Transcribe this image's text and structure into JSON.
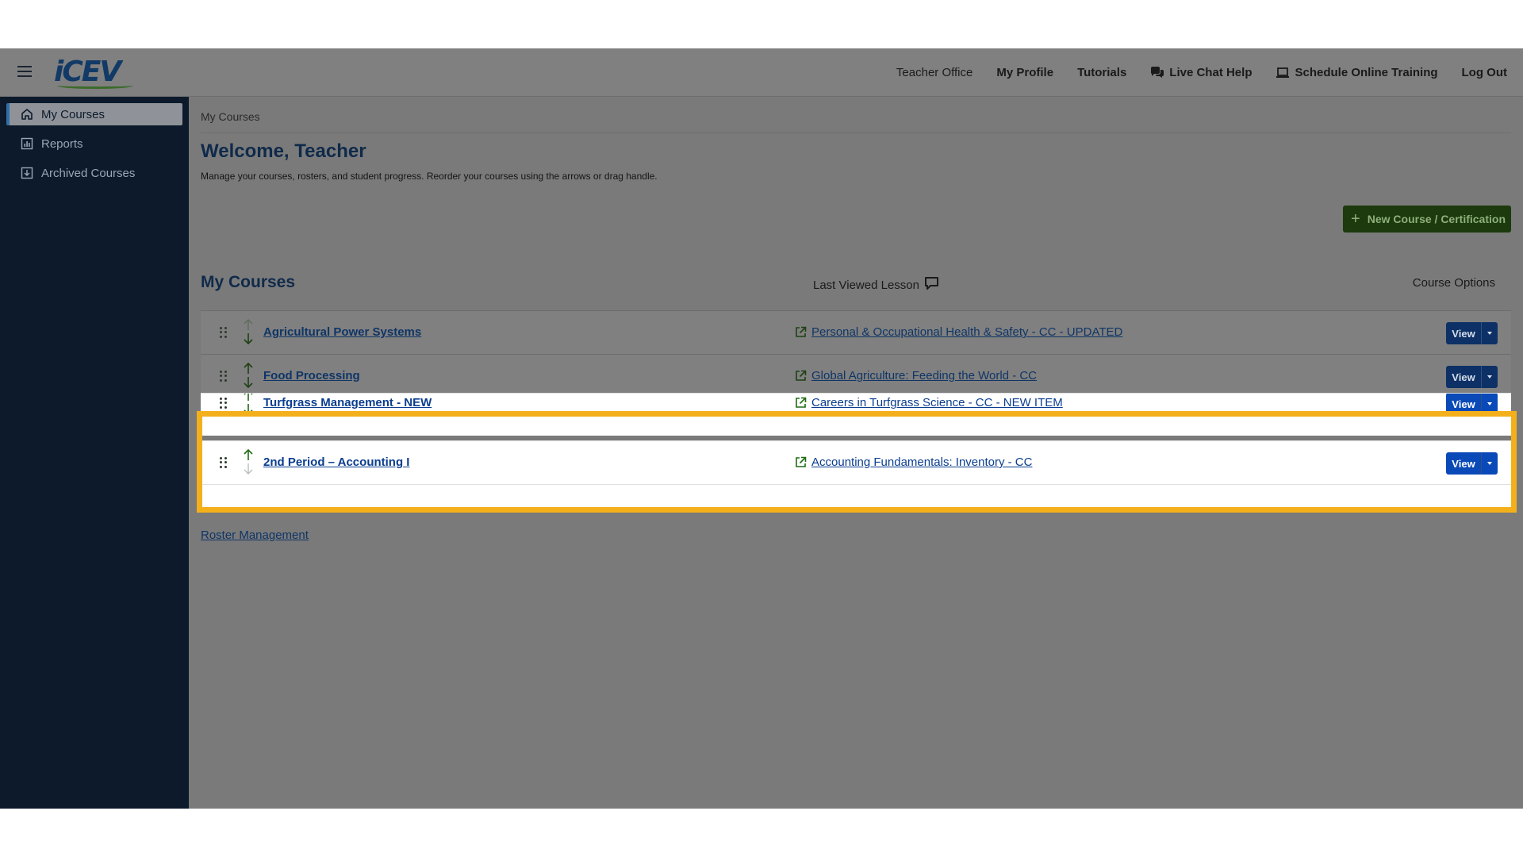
{
  "header": {
    "logo_text": "iCEV",
    "nav": [
      {
        "label": "Teacher Office",
        "icon": null
      },
      {
        "label": "My Profile",
        "icon": null
      },
      {
        "label": "Tutorials",
        "icon": null
      },
      {
        "label": "Live Chat Help",
        "icon": "chat-bubbles-icon"
      },
      {
        "label": "Schedule Online Training",
        "icon": "laptop-icon"
      },
      {
        "label": "Log Out",
        "icon": null
      }
    ]
  },
  "sidebar": {
    "items": [
      {
        "label": "My Courses",
        "icon": "home-icon",
        "active": true
      },
      {
        "label": "Reports",
        "icon": "bar-chart-icon",
        "active": false
      },
      {
        "label": "Archived Courses",
        "icon": "archive-icon",
        "active": false
      }
    ]
  },
  "main": {
    "breadcrumb": "My Courses",
    "title": "Welcome, Teacher",
    "description": "Manage your courses, rosters, and student progress. Reorder your courses using the arrows or drag handle.",
    "new_button_label": "New Course / Certification",
    "section_title": "My Courses",
    "last_viewed_label": "Last Viewed Lesson",
    "course_options_label": "Course Options",
    "view_label": "View",
    "courses": [
      {
        "name": "Agricultural Power Systems",
        "lesson": "Personal & Occupational Health & Safety - CC - UPDATED"
      },
      {
        "name": "Food Processing",
        "lesson": "Global Agriculture: Feeding the World - CC"
      },
      {
        "name": "Turfgrass Management - NEW",
        "lesson": "Careers in Turfgrass Science - CC - NEW ITEM"
      },
      {
        "name": "2nd Period – Accounting I",
        "lesson": "Accounting Fundamentals: Inventory - CC"
      }
    ],
    "roster_link": "Roster Management"
  },
  "colors": {
    "highlight": "#f4b01b",
    "sidebar_bg": "#0c1a2b",
    "new_button_bg": "#1c3a0d",
    "view_button_bg": "#0a49b8"
  }
}
